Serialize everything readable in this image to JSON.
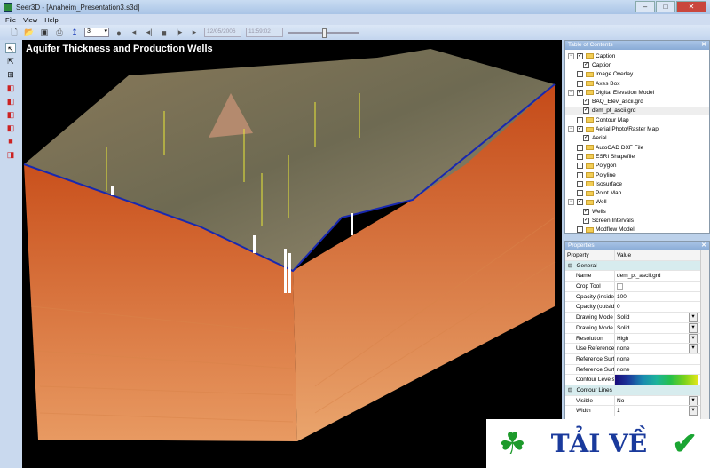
{
  "window": {
    "title": "Seer3D - [Anaheim_Presentation3.s3d]"
  },
  "menu": [
    "File",
    "View",
    "Help"
  ],
  "toolbar": {
    "layer_value": "3",
    "date": "12/05/2006",
    "time": "11:59:02"
  },
  "viewport": {
    "title": "Aquifer Thickness and Production Wells"
  },
  "toc": {
    "title": "Table of Contents",
    "items": [
      {
        "label": "Caption",
        "level": 0,
        "checked": true,
        "folder": true
      },
      {
        "label": "Caption",
        "level": 1,
        "checked": true
      },
      {
        "label": "Image Overlay",
        "level": 0,
        "checked": false,
        "folder": true
      },
      {
        "label": "Axes Box",
        "level": 0,
        "checked": false,
        "folder": true
      },
      {
        "label": "Digital Elevation Model",
        "level": 0,
        "checked": true,
        "folder": true
      },
      {
        "label": "BAQ_Elev_ascii.grd",
        "level": 1,
        "checked": true
      },
      {
        "label": "dem_pt_ascii.grd",
        "level": 1,
        "checked": true
      },
      {
        "label": "Contour Map",
        "level": 0,
        "checked": false,
        "folder": true
      },
      {
        "label": "Aerial Photo/Raster Map",
        "level": 0,
        "checked": true,
        "folder": true
      },
      {
        "label": "Aerial",
        "level": 1,
        "checked": true
      },
      {
        "label": "AutoCAD DXF File",
        "level": 0,
        "checked": false,
        "folder": true
      },
      {
        "label": "ESRI Shapefile",
        "level": 0,
        "checked": false,
        "folder": true
      },
      {
        "label": "Polygon",
        "level": 0,
        "checked": false,
        "folder": true
      },
      {
        "label": "Polyline",
        "level": 0,
        "checked": false,
        "folder": true
      },
      {
        "label": "Isosurface",
        "level": 0,
        "checked": false,
        "folder": true
      },
      {
        "label": "Point Map",
        "level": 0,
        "checked": false,
        "folder": true
      },
      {
        "label": "Well",
        "level": 0,
        "checked": true,
        "folder": true
      },
      {
        "label": "Wells",
        "level": 1,
        "checked": true
      },
      {
        "label": "Screen Intervals",
        "level": 1,
        "checked": true
      },
      {
        "label": "Modflow Model",
        "level": 0,
        "checked": false,
        "folder": true
      }
    ]
  },
  "properties": {
    "title": "Properties",
    "col_property": "Property",
    "col_value": "Value",
    "rows": [
      {
        "k": "General",
        "cat": true
      },
      {
        "k": "Name",
        "v": "dem_pt_ascii.grd"
      },
      {
        "k": "Crop Tool",
        "v": ""
      },
      {
        "k": "Opacity (inside c",
        "v": "100"
      },
      {
        "k": "Opacity (outside",
        "v": "0"
      },
      {
        "k": "Drawing Mode (",
        "v": "Solid",
        "dd": true
      },
      {
        "k": "Drawing Mode (",
        "v": "Solid",
        "dd": true
      },
      {
        "k": "Resolution",
        "v": "High",
        "dd": true
      },
      {
        "k": "Use Reference",
        "v": "none",
        "dd": true
      },
      {
        "k": "Reference Surfa",
        "v": "none"
      },
      {
        "k": "Reference Surfa",
        "v": "none"
      },
      {
        "k": "Contour Levels",
        "v": ""
      },
      {
        "k": "Contour Lines",
        "cat": true
      },
      {
        "k": "Visible",
        "v": "No",
        "dd": true
      },
      {
        "k": "Width",
        "v": "1",
        "dd": true
      }
    ]
  },
  "watermark": {
    "text": "TẢI VỀ"
  }
}
